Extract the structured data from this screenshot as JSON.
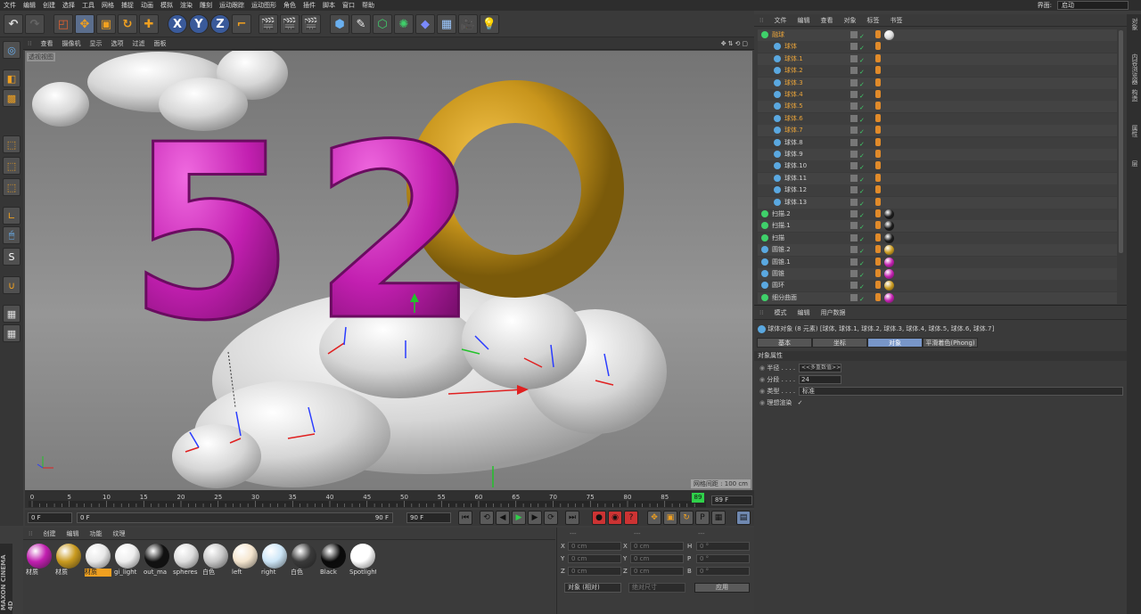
{
  "menu": [
    "文件",
    "编辑",
    "创建",
    "选择",
    "工具",
    "网格",
    "捕捉",
    "动画",
    "模拟",
    "渲染",
    "雕刻",
    "运动跟踪",
    "运动图形",
    "角色",
    "插件",
    "脚本",
    "窗口",
    "帮助"
  ],
  "layout": {
    "label": "界面:",
    "value": "启动"
  },
  "viewport": {
    "menu": [
      "查看",
      "摄像机",
      "显示",
      "选项",
      "过滤",
      "面板"
    ],
    "view_name": "透视视图",
    "grid_spacing": "网格间距 : 100 cm",
    "digits": [
      "5",
      "2",
      "0"
    ]
  },
  "timeline": {
    "ticks": [
      "0",
      "5",
      "10",
      "15",
      "20",
      "25",
      "30",
      "35",
      "40",
      "45",
      "50",
      "55",
      "60",
      "65",
      "70",
      "75",
      "80",
      "85"
    ],
    "current_marker": "89",
    "end_field": "89 F"
  },
  "controls": {
    "start": "0 F",
    "slider_start": "0 F",
    "slider_end": "90 F",
    "end": "90 F"
  },
  "materials": {
    "menu": [
      "创建",
      "编辑",
      "功能",
      "纹理"
    ],
    "items": [
      {
        "label": "材质",
        "color": "#c21fb0"
      },
      {
        "label": "材质",
        "color": "#c99a1f"
      },
      {
        "label": "材质",
        "color": "#e8e8e8",
        "selected": true
      },
      {
        "label": "gi_light",
        "color": "#eeeeee"
      },
      {
        "label": "out_ma",
        "color": "#111111"
      },
      {
        "label": "spheres",
        "color": "#dddddd"
      },
      {
        "label": "白色",
        "color": "#c8c8c8"
      },
      {
        "label": "left",
        "color": "#f5e6cf"
      },
      {
        "label": "right",
        "color": "#cde6f7"
      },
      {
        "label": "白色",
        "color": "#3a3a3a"
      },
      {
        "label": "Black",
        "color": "#0a0a0a"
      },
      {
        "label": "Spotlight",
        "color": "#ffffff"
      }
    ]
  },
  "coords": {
    "head": [
      "---",
      "---",
      "---"
    ],
    "rows": [
      {
        "a": "X",
        "av": "0 cm",
        "b": "X",
        "bv": "0 cm",
        "c": "H",
        "cv": "0 °"
      },
      {
        "a": "Y",
        "av": "0 cm",
        "b": "Y",
        "bv": "0 cm",
        "c": "P",
        "cv": "0 °"
      },
      {
        "a": "Z",
        "av": "0 cm",
        "b": "Z",
        "bv": "0 cm",
        "c": "B",
        "cv": "0 °"
      }
    ],
    "mode": "对象 (相对)",
    "size": "绝对尺寸",
    "apply": "应用"
  },
  "objects": {
    "menu": [
      "文件",
      "编辑",
      "查看",
      "对象",
      "标签",
      "书签"
    ],
    "items": [
      {
        "name": "融球",
        "type": "group",
        "color": "#e8a33a",
        "indent": 0,
        "tag": "#dddddd"
      },
      {
        "name": "球体",
        "type": "sphere",
        "color": "#e8a33a",
        "indent": 1
      },
      {
        "name": "球体.1",
        "type": "sphere",
        "color": "#e8a33a",
        "indent": 1
      },
      {
        "name": "球体.2",
        "type": "sphere",
        "color": "#e8a33a",
        "indent": 1
      },
      {
        "name": "球体.3",
        "type": "sphere",
        "color": "#e8a33a",
        "indent": 1
      },
      {
        "name": "球体.4",
        "type": "sphere",
        "color": "#e8a33a",
        "indent": 1
      },
      {
        "name": "球体.5",
        "type": "sphere",
        "color": "#e8a33a",
        "indent": 1
      },
      {
        "name": "球体.6",
        "type": "sphere",
        "color": "#e8a33a",
        "indent": 1
      },
      {
        "name": "球体.7",
        "type": "sphere",
        "color": "#e8a33a",
        "indent": 1
      },
      {
        "name": "球体.8",
        "type": "sphere",
        "color": "#cfcfcf",
        "indent": 1
      },
      {
        "name": "球体.9",
        "type": "sphere",
        "color": "#cfcfcf",
        "indent": 1
      },
      {
        "name": "球体.10",
        "type": "sphere",
        "color": "#cfcfcf",
        "indent": 1
      },
      {
        "name": "球体.11",
        "type": "sphere",
        "color": "#cfcfcf",
        "indent": 1
      },
      {
        "name": "球体.12",
        "type": "sphere",
        "color": "#cfcfcf",
        "indent": 1
      },
      {
        "name": "球体.13",
        "type": "sphere",
        "color": "#cfcfcf",
        "indent": 1
      },
      {
        "name": "扫描.2",
        "type": "sweep",
        "color": "#cfcfcf",
        "indent": 0,
        "tag": "#1a1a1a"
      },
      {
        "name": "扫描.1",
        "type": "sweep",
        "color": "#cfcfcf",
        "indent": 0,
        "tag": "#1a1a1a"
      },
      {
        "name": "扫描",
        "type": "sweep",
        "color": "#cfcfcf",
        "indent": 0,
        "tag": "#1a1a1a"
      },
      {
        "name": "圆锥.2",
        "type": "cone",
        "color": "#cfcfcf",
        "indent": 0,
        "tag": "#c99a1f"
      },
      {
        "name": "圆锥.1",
        "type": "cone",
        "color": "#cfcfcf",
        "indent": 0,
        "tag": "#c21fb0"
      },
      {
        "name": "圆锥",
        "type": "cone",
        "color": "#cfcfcf",
        "indent": 0,
        "tag": "#c21fb0"
      },
      {
        "name": "圆环",
        "type": "torus",
        "color": "#cfcfcf",
        "indent": 0,
        "tag": "#c99a1f"
      },
      {
        "name": "细分曲面",
        "type": "subdiv",
        "color": "#cfcfcf",
        "indent": 0,
        "tag": "#c21fb0"
      }
    ]
  },
  "attributes": {
    "menu": [
      "模式",
      "编辑",
      "用户数据"
    ],
    "title": "球体对象 (8 元素) [球体, 球体.1, 球体.2, 球体.3, 球体.4, 球体.5, 球体.6, 球体.7]",
    "tabs": [
      "基本",
      "坐标",
      "对象",
      "平滑着色(Phong)"
    ],
    "section": "对象属性",
    "radius_label": "半径 . . . .",
    "radius_value": "<<多重数值>>",
    "segments_label": "分段 . . . .",
    "segments_value": "24",
    "type_label": "类型 . . . .",
    "type_value": "标准",
    "render_label": "理想渲染",
    "render_value": "✓"
  },
  "rightstrip": [
    "对象",
    "内容浏览器",
    "构造",
    "属性",
    "层"
  ],
  "brand": "MAXON CINEMA 4D"
}
